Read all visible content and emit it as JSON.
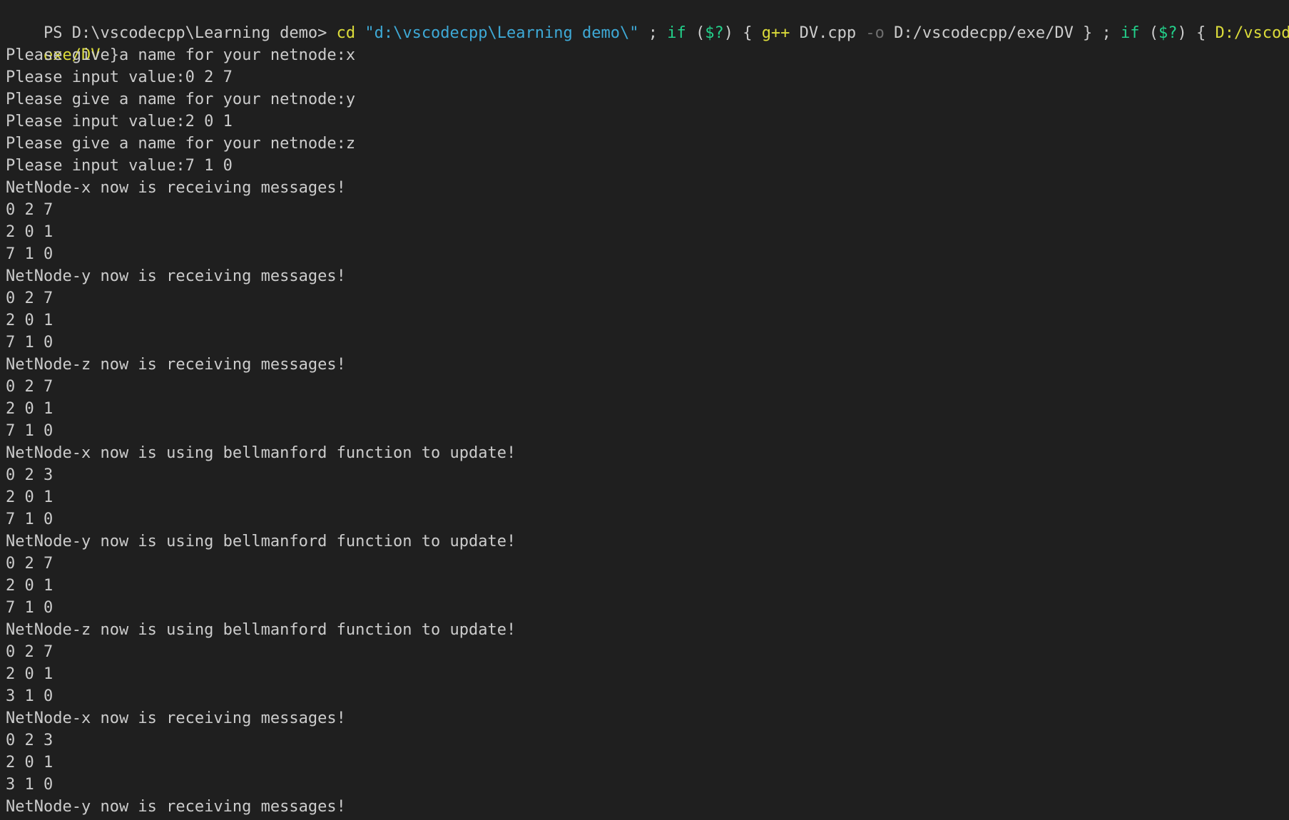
{
  "terminal": {
    "prompt": {
      "ps": "PS D:\\vscodecpp\\Learning demo> ",
      "cmd_cd": "cd",
      "sp1": " ",
      "path_str": "\"d:\\vscodecpp\\Learning demo\\\"",
      "sep1": " ; ",
      "if1": "if",
      "open1": " (",
      "status1": "$?",
      "close1": ") { ",
      "compiler": "g++",
      "source": " DV.cpp ",
      "flag": "-o",
      "out_path": " D:/vscodecpp/exe/DV } ; ",
      "if2": "if",
      "open2": " (",
      "status2": "$?",
      "close2": ") { ",
      "exe_line1": "D:/vscodecpp/",
      "exe_line2": "exe/DV",
      "end": " }"
    },
    "output": [
      "Please give a name for your netnode:x",
      "Please input value:0 2 7",
      "Please give a name for your netnode:y",
      "Please input value:2 0 1",
      "Please give a name for your netnode:z",
      "Please input value:7 1 0",
      "NetNode-x now is receiving messages!",
      "0 2 7",
      "2 0 1",
      "7 1 0",
      "NetNode-y now is receiving messages!",
      "0 2 7",
      "2 0 1",
      "7 1 0",
      "NetNode-z now is receiving messages!",
      "0 2 7",
      "2 0 1",
      "7 1 0",
      "NetNode-x now is using bellmanford function to update!",
      "0 2 3",
      "2 0 1",
      "7 1 0",
      "NetNode-y now is using bellmanford function to update!",
      "0 2 7",
      "2 0 1",
      "7 1 0",
      "NetNode-z now is using bellmanford function to update!",
      "0 2 7",
      "2 0 1",
      "3 1 0",
      "NetNode-x now is receiving messages!",
      "0 2 3",
      "2 0 1",
      "3 1 0",
      "NetNode-y now is receiving messages!"
    ],
    "colors": {
      "background": "#1f1f1f",
      "text": "#cccccc",
      "command": "#dcdc3a",
      "string": "#3ea9d6",
      "keyword": "#23d18b",
      "flag": "#6f6f6f"
    }
  }
}
